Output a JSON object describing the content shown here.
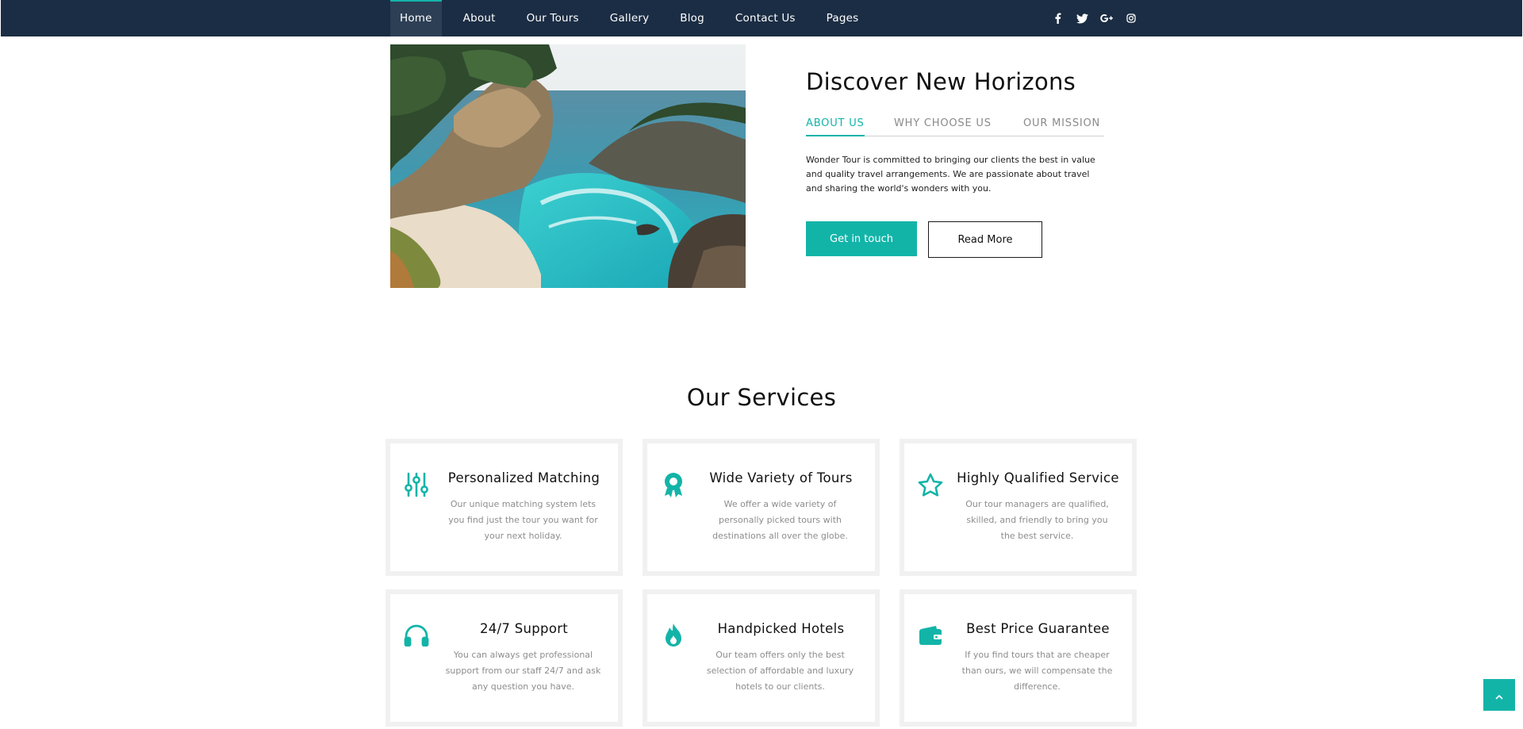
{
  "nav": {
    "items": [
      {
        "label": "Home",
        "active": true
      },
      {
        "label": "About",
        "active": false
      },
      {
        "label": "Our Tours",
        "active": false
      },
      {
        "label": "Gallery",
        "active": false
      },
      {
        "label": "Blog",
        "active": false
      },
      {
        "label": "Contact Us",
        "active": false
      },
      {
        "label": "Pages",
        "active": false
      }
    ],
    "social_icons": [
      "facebook-icon",
      "twitter-icon",
      "google-plus-icon",
      "instagram-icon"
    ]
  },
  "hero": {
    "image": "coastal-cove-photo",
    "title": "Discover New Horizons",
    "tabs": [
      {
        "label": "ABOUT US",
        "active": true
      },
      {
        "label": "WHY CHOOSE US",
        "active": false
      },
      {
        "label": "OUR MISSION",
        "active": false
      }
    ],
    "text": "Wonder Tour is committed to bringing our clients the best in value and quality travel arrangements. We are passionate about travel and sharing the world's wonders with you.",
    "primary_button": "Get in touch",
    "secondary_button": "Read More"
  },
  "services": {
    "title": "Our Services",
    "items": [
      {
        "icon": "sliders-icon",
        "title": "Personalized Matching",
        "description": "Our unique matching system lets you find just the tour you want for your next holiday."
      },
      {
        "icon": "award-icon",
        "title": "Wide Variety of Tours",
        "description": "We offer a wide variety of personally picked tours with destinations all over the globe."
      },
      {
        "icon": "star-icon",
        "title": "Highly Qualified Service",
        "description": "Our tour managers are qualified, skilled, and friendly to bring you the best service."
      },
      {
        "icon": "headphones-icon",
        "title": "24/7 Support",
        "description": "You can always get professional support from our staff 24/7 and ask any question you have."
      },
      {
        "icon": "flame-icon",
        "title": "Handpicked Hotels",
        "description": "Our team offers only the best selection of affordable and luxury hotels to our clients."
      },
      {
        "icon": "wallet-icon",
        "title": "Best Price Guarantee",
        "description": "If you find tours that are cheaper than ours, we will compensate the difference."
      }
    ]
  },
  "colors": {
    "navbar": "#1b2d44",
    "accent": "#13b4a8",
    "card_border": "#f1f1f1",
    "muted_text": "#8d8d8d"
  },
  "scroll_top_icon": "chevron-up-icon"
}
